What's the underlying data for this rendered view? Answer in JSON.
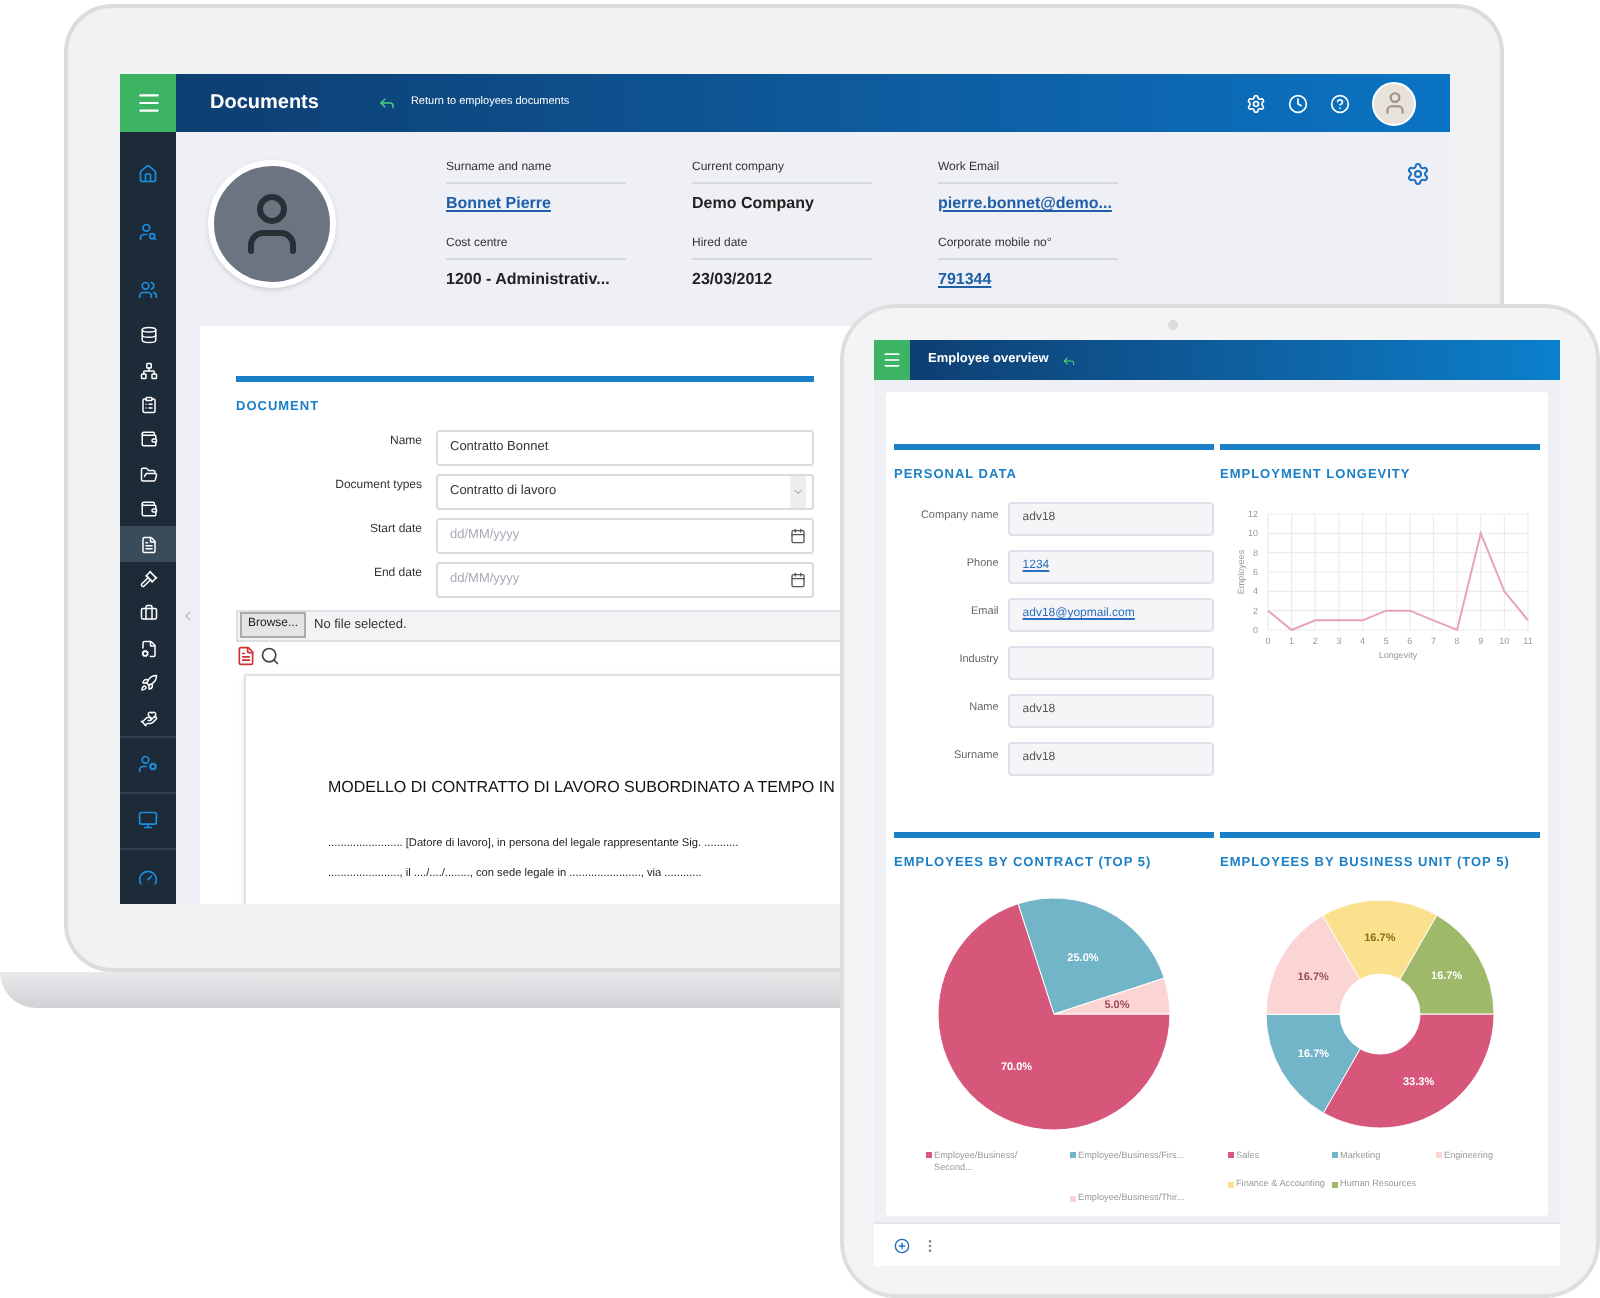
{
  "laptop": {
    "header": {
      "title": "Documents",
      "back_link": "Return to employees documents"
    },
    "sidebar": {
      "items": [
        {
          "selected": false
        },
        {
          "selected": false
        },
        {
          "selected": false
        },
        {
          "selected": false
        },
        {
          "selected": false
        },
        {
          "selected": false
        },
        {
          "selected": false
        },
        {
          "selected": false
        },
        {
          "selected": false
        },
        {
          "selected": true
        },
        {
          "selected": false
        },
        {
          "selected": false
        },
        {
          "selected": false
        },
        {
          "selected": false
        },
        {
          "selected": false
        },
        {
          "selected": false
        },
        {
          "selected": false
        },
        {
          "selected": false
        }
      ]
    },
    "profile": {
      "fields": [
        {
          "label": "Surname and name",
          "value": "Bonnet Pierre",
          "kind": "link"
        },
        {
          "label": "Current company",
          "value": "Demo Company",
          "kind": "text"
        },
        {
          "label": "Work Email",
          "value": "pierre.bonnet@demo...",
          "kind": "link"
        },
        {
          "label": "Cost centre",
          "value": "1200 - Administrativ...",
          "kind": "text"
        },
        {
          "label": "Hired date",
          "value": "23/03/2012",
          "kind": "text"
        },
        {
          "label": "Corporate mobile no°",
          "value": "791344",
          "kind": "link"
        }
      ]
    },
    "document": {
      "heading": "DOCUMENT",
      "fields": [
        {
          "label": "Name",
          "kind": "text",
          "value": "Contratto Bonnet"
        },
        {
          "label": "Document types",
          "kind": "select",
          "value": "Contratto di lavoro"
        },
        {
          "label": "Start date",
          "kind": "date",
          "placeholder": "dd/MM/yyyy"
        },
        {
          "label": "End date",
          "kind": "date",
          "placeholder": "dd/MM/yyyy"
        }
      ],
      "browse_button": "Browse...",
      "file_status": "No file selected.",
      "preview": {
        "title": "MODELLO DI CONTRATTO DI LAVORO SUBORDINATO A TEMPO IN",
        "lines": [
          "........................ [Datore di lavoro], in persona del legale rappresentante Sig. ...........",
          "......................., il ..../..../........, con sede legale in ......................., via ............"
        ]
      }
    }
  },
  "tablet": {
    "header": {
      "title": "Employee overview"
    },
    "personal_data": {
      "heading": "PERSONAL DATA",
      "fields": [
        {
          "label": "Company name",
          "value": "adv18",
          "kind": "text"
        },
        {
          "label": "Phone",
          "value": "1234",
          "kind": "link"
        },
        {
          "label": "Email",
          "value": "adv18@yopmail.com",
          "kind": "link"
        },
        {
          "label": "Industry",
          "kind": "text"
        },
        {
          "label": "Name",
          "value": "adv18",
          "kind": "text"
        },
        {
          "label": "Surname",
          "value": "adv18",
          "kind": "text"
        }
      ]
    },
    "longevity": {
      "heading": "EMPLOYMENT LONGEVITY",
      "chart_data": {
        "type": "line",
        "xlabel": "Longevity",
        "ylabel": "Employees",
        "x": [
          0,
          1,
          2,
          3,
          4,
          5,
          6,
          7,
          8,
          9,
          10,
          11
        ],
        "series": [
          {
            "color": "#e8a3b8",
            "values": [
              2,
              0,
              1,
              1,
              1,
              2,
              2,
              1,
              0,
              10,
              4,
              1
            ]
          }
        ],
        "grid": true,
        "xlim": [
          0,
          11
        ],
        "ylim": [
          0,
          12
        ],
        "xticks": [
          0,
          1,
          2,
          3,
          4,
          5,
          6,
          7,
          8,
          9,
          10,
          11
        ],
        "yticks": [
          0,
          2,
          4,
          6,
          8,
          10,
          12
        ]
      }
    },
    "contract": {
      "heading": "EMPLOYEES BY CONTRACT (TOP 5)",
      "chart_data": {
        "type": "pie",
        "categories": [
          "Employee/Business/Second...",
          "Employee/Business/Firs...",
          "Employee/Business/Thir..."
        ],
        "series": [
          {
            "values": [
              70,
              25,
              5
            ]
          }
        ],
        "value_labels": [
          "70.0%",
          "25.0%",
          "5.0%"
        ]
      }
    },
    "business_unit": {
      "heading": "EMPLOYEES BY BUSINESS UNIT (TOP 5)",
      "chart_data": {
        "type": "donut",
        "categories": [
          "Sales",
          "Marketing",
          "Engineering",
          "Finance & Accounting",
          "Human Resources"
        ],
        "series": [
          {
            "values": [
              33.3,
              16.7,
              16.7,
              16.7,
              16.7
            ]
          }
        ],
        "value_labels": [
          "33.3%",
          "16.7%",
          "16.7%",
          "16.7%",
          "16.7%"
        ]
      }
    }
  }
}
